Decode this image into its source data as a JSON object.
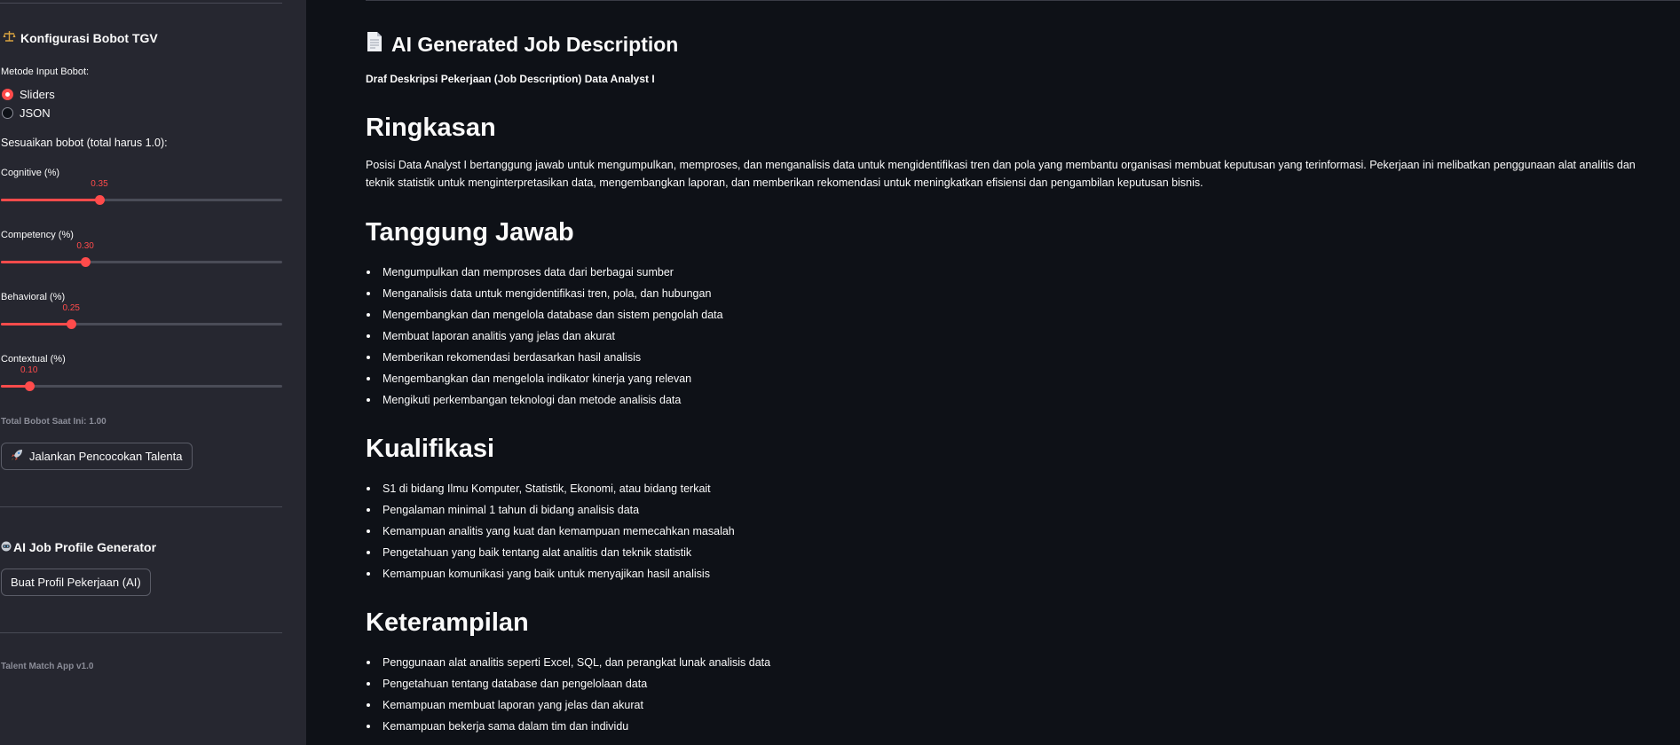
{
  "sidebar": {
    "config_heading": "Konfigurasi Bobot TGV",
    "input_method_label": "Metode Input Bobot:",
    "radio_options": [
      "Sliders",
      "JSON"
    ],
    "selected_option": "Sliders",
    "weights_instruction": "Sesuaikan bobot (total harus 1.0):",
    "sliders": [
      {
        "label": "Cognitive (%)",
        "value": 0.35,
        "display": "0.35"
      },
      {
        "label": "Competency (%)",
        "value": 0.3,
        "display": "0.30"
      },
      {
        "label": "Behavioral (%)",
        "value": 0.25,
        "display": "0.25"
      },
      {
        "label": "Contextual (%)",
        "value": 0.1,
        "display": "0.10"
      }
    ],
    "total_text": "Total Bobot Saat Ini: 1.00",
    "run_button": "Jalankan Pencocokan Talenta",
    "ai_heading": "AI Job Profile Generator",
    "generate_button": "Buat Profil Pekerjaan (AI)",
    "version": "Talent Match App v1.0"
  },
  "main": {
    "title": "AI Generated Job Description",
    "subtitle": "Draf Deskripsi Pekerjaan (Job Description) Data Analyst I",
    "sections": {
      "summary": {
        "heading": "Ringkasan",
        "text": "Posisi Data Analyst I bertanggung jawab untuk mengumpulkan, memproses, dan menganalisis data untuk mengidentifikasi tren dan pola yang membantu organisasi membuat keputusan yang terinformasi. Pekerjaan ini melibatkan penggunaan alat analitis dan teknik statistik untuk menginterpretasikan data, mengembangkan laporan, dan memberikan rekomendasi untuk meningkatkan efisiensi dan pengambilan keputusan bisnis."
      },
      "responsibilities": {
        "heading": "Tanggung Jawab",
        "items": [
          "Mengumpulkan dan memproses data dari berbagai sumber",
          "Menganalisis data untuk mengidentifikasi tren, pola, dan hubungan",
          "Mengembangkan dan mengelola database dan sistem pengolah data",
          "Membuat laporan analitis yang jelas dan akurat",
          "Memberikan rekomendasi berdasarkan hasil analisis",
          "Mengembangkan dan mengelola indikator kinerja yang relevan",
          "Mengikuti perkembangan teknologi dan metode analisis data"
        ]
      },
      "qualifications": {
        "heading": "Kualifikasi",
        "items": [
          "S1 di bidang Ilmu Komputer, Statistik, Ekonomi, atau bidang terkait",
          "Pengalaman minimal 1 tahun di bidang analisis data",
          "Kemampuan analitis yang kuat dan kemampuan memecahkan masalah",
          "Pengetahuan yang baik tentang alat analitis dan teknik statistik",
          "Kemampuan komunikasi yang baik untuk menyajikan hasil analisis"
        ]
      },
      "skills": {
        "heading": "Keterampilan",
        "items": [
          "Penggunaan alat analitis seperti Excel, SQL, dan perangkat lunak analisis data",
          "Pengetahuan tentang database dan pengelolaan data",
          "Kemampuan membuat laporan yang jelas dan akurat",
          "Kemampuan bekerja sama dalam tim dan individu"
        ]
      }
    }
  },
  "icons": {
    "config": "balance-scale-icon",
    "ai": "robot-icon",
    "run": "rocket-icon",
    "title": "document-icon"
  },
  "colors": {
    "background": "#0e1117",
    "sidebar": "#262730",
    "accent": "#ff4b4b",
    "text": "#fafafa",
    "muted": "#8b8d98"
  }
}
